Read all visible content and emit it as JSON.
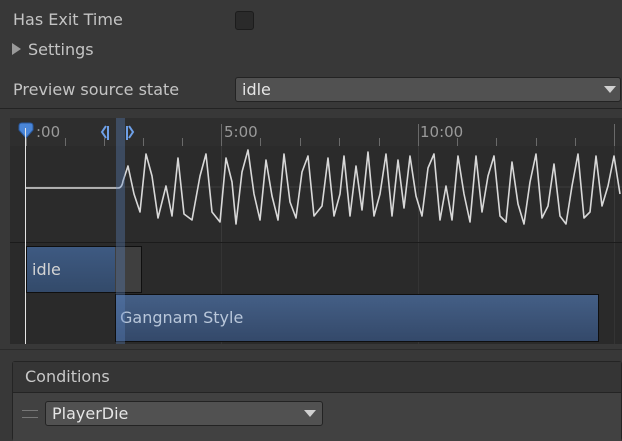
{
  "inspector": {
    "has_exit_time_label": "Has Exit Time",
    "has_exit_time_checked": false,
    "settings_label": "Settings",
    "preview_label": "Preview source state",
    "preview_value": "idle"
  },
  "timeline": {
    "ticks": [
      ":00",
      "5:00",
      "10:00"
    ],
    "clips": [
      {
        "label": "idle"
      },
      {
        "label": "Gangnam Style"
      }
    ]
  },
  "conditions": {
    "header": "Conditions",
    "items": [
      {
        "parameter": "PlayerDie"
      }
    ]
  },
  "colors": {
    "background": "#383838",
    "clip_blue": "#3e5a82",
    "timeline_bg": "#262626",
    "playhead_marker": "#4a86d8"
  }
}
